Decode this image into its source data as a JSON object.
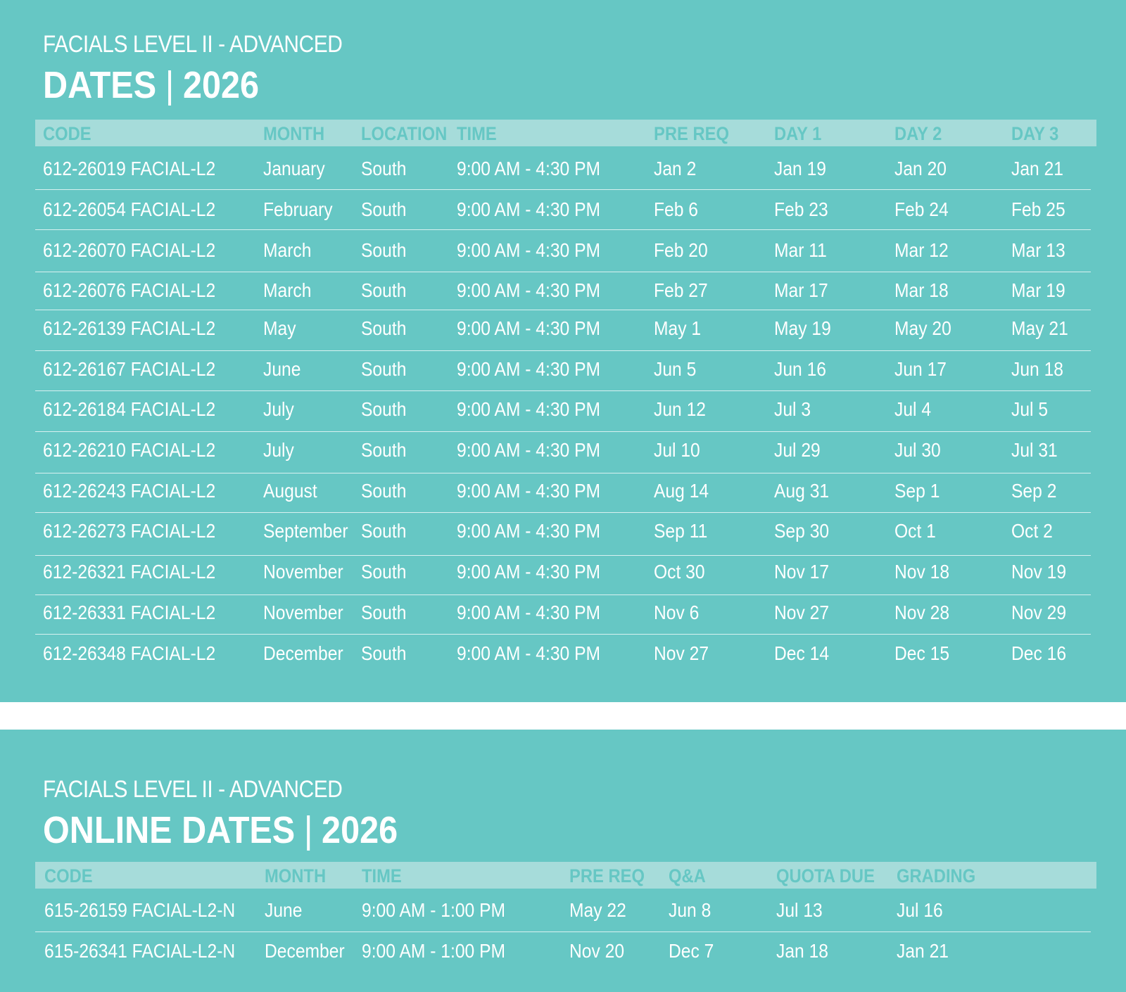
{
  "in_person": {
    "subtitle": "FACIALS LEVEL II - ADVANCED",
    "title_main": "DATES",
    "title_sep": "|",
    "title_year": "2026",
    "columns": [
      "CODE",
      "MONTH",
      "LOCATION",
      "TIME",
      "PRE REQ",
      "DAY 1",
      "DAY 2",
      "DAY 3"
    ],
    "rows": [
      [
        "612-26019 FACIAL-L2",
        "January",
        "South",
        "9:00 AM - 4:30 PM",
        "Jan 2",
        "Jan 19",
        "Jan 20",
        "Jan 21"
      ],
      [
        "612-26054 FACIAL-L2",
        "February",
        "South",
        "9:00 AM - 4:30 PM",
        "Feb 6",
        "Feb 23",
        "Feb 24",
        "Feb 25"
      ],
      [
        "612-26070 FACIAL-L2",
        "March",
        "South",
        "9:00 AM - 4:30 PM",
        "Feb 20",
        "Mar 11",
        "Mar 12",
        "Mar 13"
      ],
      [
        "612-26076 FACIAL-L2",
        "March",
        "South",
        "9:00 AM - 4:30 PM",
        "Feb 27",
        "Mar 17",
        "Mar 18",
        "Mar 19"
      ],
      [
        "612-26139 FACIAL-L2",
        "May",
        "South",
        "9:00 AM - 4:30 PM",
        "May 1",
        "May 19",
        "May 20",
        "May 21"
      ],
      [
        "612-26167 FACIAL-L2",
        "June",
        "South",
        "9:00 AM - 4:30 PM",
        "Jun 5",
        "Jun 16",
        "Jun 17",
        "Jun 18"
      ],
      [
        "612-26184 FACIAL-L2",
        "July",
        "South",
        "9:00 AM - 4:30 PM",
        "Jun 12",
        "Jul 3",
        "Jul 4",
        "Jul 5"
      ],
      [
        "612-26210 FACIAL-L2",
        "July",
        "South",
        "9:00 AM - 4:30 PM",
        "Jul 10",
        "Jul 29",
        "Jul 30",
        "Jul 31"
      ],
      [
        "612-26243 FACIAL-L2",
        "August",
        "South",
        "9:00 AM - 4:30 PM",
        "Aug 14",
        "Aug 31",
        "Sep 1",
        "Sep 2"
      ],
      [
        "612-26273 FACIAL-L2",
        "September",
        "South",
        "9:00 AM - 4:30 PM",
        "Sep 11",
        "Sep 30",
        "Oct 1",
        "Oct 2"
      ],
      [
        "612-26321 FACIAL-L2",
        "November",
        "South",
        "9:00 AM - 4:30 PM",
        "Oct 30",
        "Nov 17",
        "Nov 18",
        "Nov 19"
      ],
      [
        "612-26331 FACIAL-L2",
        "November",
        "South",
        "9:00 AM - 4:30 PM",
        "Nov 6",
        "Nov 27",
        "Nov 28",
        "Nov 29"
      ],
      [
        "612-26348 FACIAL-L2",
        "December",
        "South",
        "9:00 AM - 4:30 PM",
        "Nov 27",
        "Dec 14",
        "Dec 15",
        "Dec 16"
      ]
    ]
  },
  "online": {
    "subtitle": "FACIALS LEVEL II - ADVANCED",
    "title_main": "ONLINE DATES",
    "title_sep": "|",
    "title_year": "2026",
    "columns": [
      "CODE",
      "MONTH",
      "TIME",
      "PRE REQ",
      "Q&A",
      "QUOTA DUE",
      "GRADING"
    ],
    "rows": [
      [
        "615-26159 FACIAL-L2-N",
        "June",
        "9:00 AM - 1:00 PM",
        "May 22",
        "Jun 8",
        "Jul 13",
        "Jul 16"
      ],
      [
        "615-26341 FACIAL-L2-N",
        "December",
        "9:00 AM - 1:00 PM",
        "Nov 20",
        "Dec 7",
        "Jan 18",
        "Jan 21"
      ]
    ]
  },
  "colors": {
    "panel": "#66c7c4",
    "header_band": "#a6dcda",
    "header_text": "#66c7c4",
    "text": "#ffffff"
  }
}
